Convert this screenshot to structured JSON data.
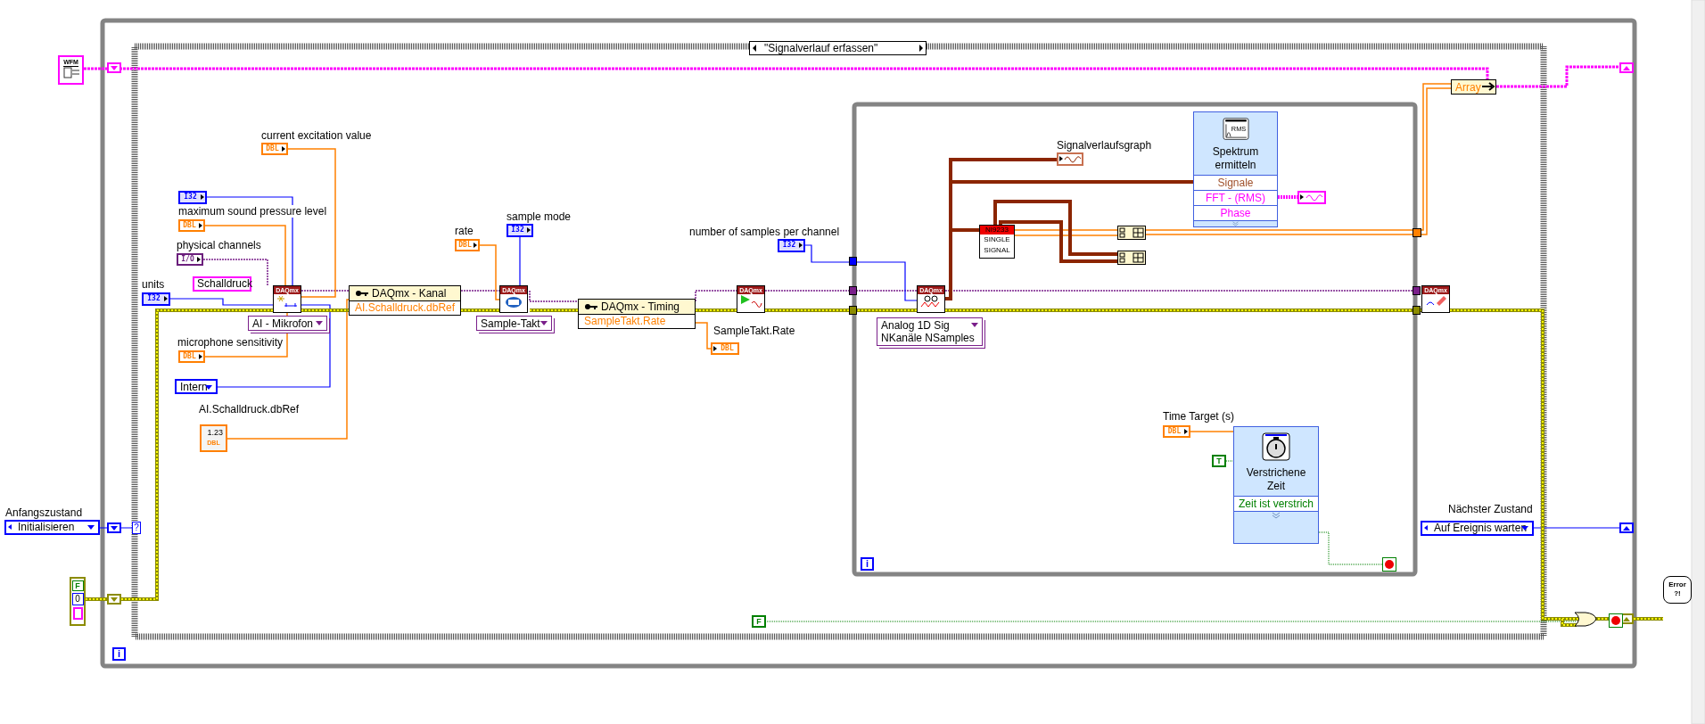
{
  "case_structure": {
    "selector": "\"Signalverlauf erfassen\"",
    "selector_terminal": "?"
  },
  "loops": [
    {
      "iteration": "i"
    },
    {
      "iteration": "i"
    }
  ],
  "waveform_constant": {
    "tag": "WFM"
  },
  "cluster_constant": {
    "boolean": "F",
    "number": "0"
  },
  "state_enums": [
    {
      "label": "Anfangszustand",
      "value": "Initialisieren"
    },
    {
      "label": "Nächster Zustand",
      "value": "Auf Ereignis warten"
    }
  ],
  "terminals": [
    {
      "label": "current excitation value",
      "kind": "numeric",
      "type": "DBL",
      "indicator": false
    },
    {
      "kind": "integer",
      "type": "I32",
      "indicator": false
    },
    {
      "label": "maximum sound pressure level",
      "kind": "numeric",
      "type": "DBL",
      "indicator": false
    },
    {
      "label": "physical channels",
      "kind": "io",
      "type": "I/O",
      "indicator": false
    },
    {
      "label": "units",
      "kind": "integer",
      "type": "I32",
      "indicator": false
    },
    {
      "label": "microphone sensitivity",
      "kind": "numeric",
      "type": "DBL",
      "indicator": false
    },
    {
      "label": "rate",
      "kind": "numeric",
      "type": "DBL",
      "indicator": false
    },
    {
      "label": "sample mode",
      "kind": "integer",
      "type": "I32",
      "indicator": false
    },
    {
      "label": "number of samples per channel",
      "kind": "integer",
      "type": "I32",
      "indicator": false
    },
    {
      "label": "SampleTakt.Rate",
      "kind": "numeric",
      "type": "DBL",
      "indicator": true
    },
    {
      "label": "Signalverlaufsgraph",
      "kind": "waveform",
      "indicator": true
    },
    {
      "kind": "spectrum",
      "indicator": true
    },
    {
      "label": "Time Target (s)",
      "kind": "numeric",
      "type": "DBL",
      "indicator": false
    }
  ],
  "string_constant": "Schalldruck",
  "numeric_control": {
    "label": "AI.Schalldruck.dbRef",
    "display": "1.23",
    "type": "DBL"
  },
  "rings": [
    {
      "lines": [
        "AI - Mikrofon"
      ],
      "kind": "ring"
    },
    {
      "lines": [
        "Intern"
      ],
      "kind": "enum"
    },
    {
      "lines": [
        "Sample-Takt"
      ],
      "kind": "ring"
    },
    {
      "lines": [
        "Analog 1D Sig",
        "NKanäle NSamples"
      ],
      "kind": "ring"
    }
  ],
  "daqmx_nodes": [
    {
      "header": "DAQmx",
      "kind": "create"
    },
    {
      "header": "DAQmx",
      "kind": "timing"
    },
    {
      "header": "DAQmx",
      "kind": "start"
    },
    {
      "header": "DAQmx",
      "kind": "read"
    },
    {
      "header": "DAQmx",
      "kind": "clear"
    }
  ],
  "property_nodes": [
    {
      "title": "DAQmx - Kanal",
      "property": "AI.Schalldruck.dbRef"
    },
    {
      "title": "DAQmx - Timing",
      "property": "SampleTakt.Rate"
    }
  ],
  "signal_node": {
    "header": "NI9233",
    "lines": [
      "SINGLE",
      "SIGNAL"
    ]
  },
  "express_vis": [
    {
      "kind": "spectrum",
      "icon_text": "RMS",
      "title": [
        "Spektrum",
        "ermitteln"
      ],
      "rows": [
        {
          "text": "Signale",
          "kind": "signal"
        },
        {
          "text": "FFT - (RMS)",
          "kind": "spectrum"
        },
        {
          "text": "Phase",
          "kind": "spectrum"
        }
      ]
    },
    {
      "kind": "timer",
      "title": [
        "Verstrichene",
        "Zeit"
      ],
      "rows": [
        {
          "text": "Zeit ist verstrich",
          "kind": "boolean"
        }
      ]
    }
  ],
  "boolean_constants": [
    "T",
    "F"
  ],
  "array_node": "Array",
  "error_handler": [
    "Error",
    "?!"
  ]
}
